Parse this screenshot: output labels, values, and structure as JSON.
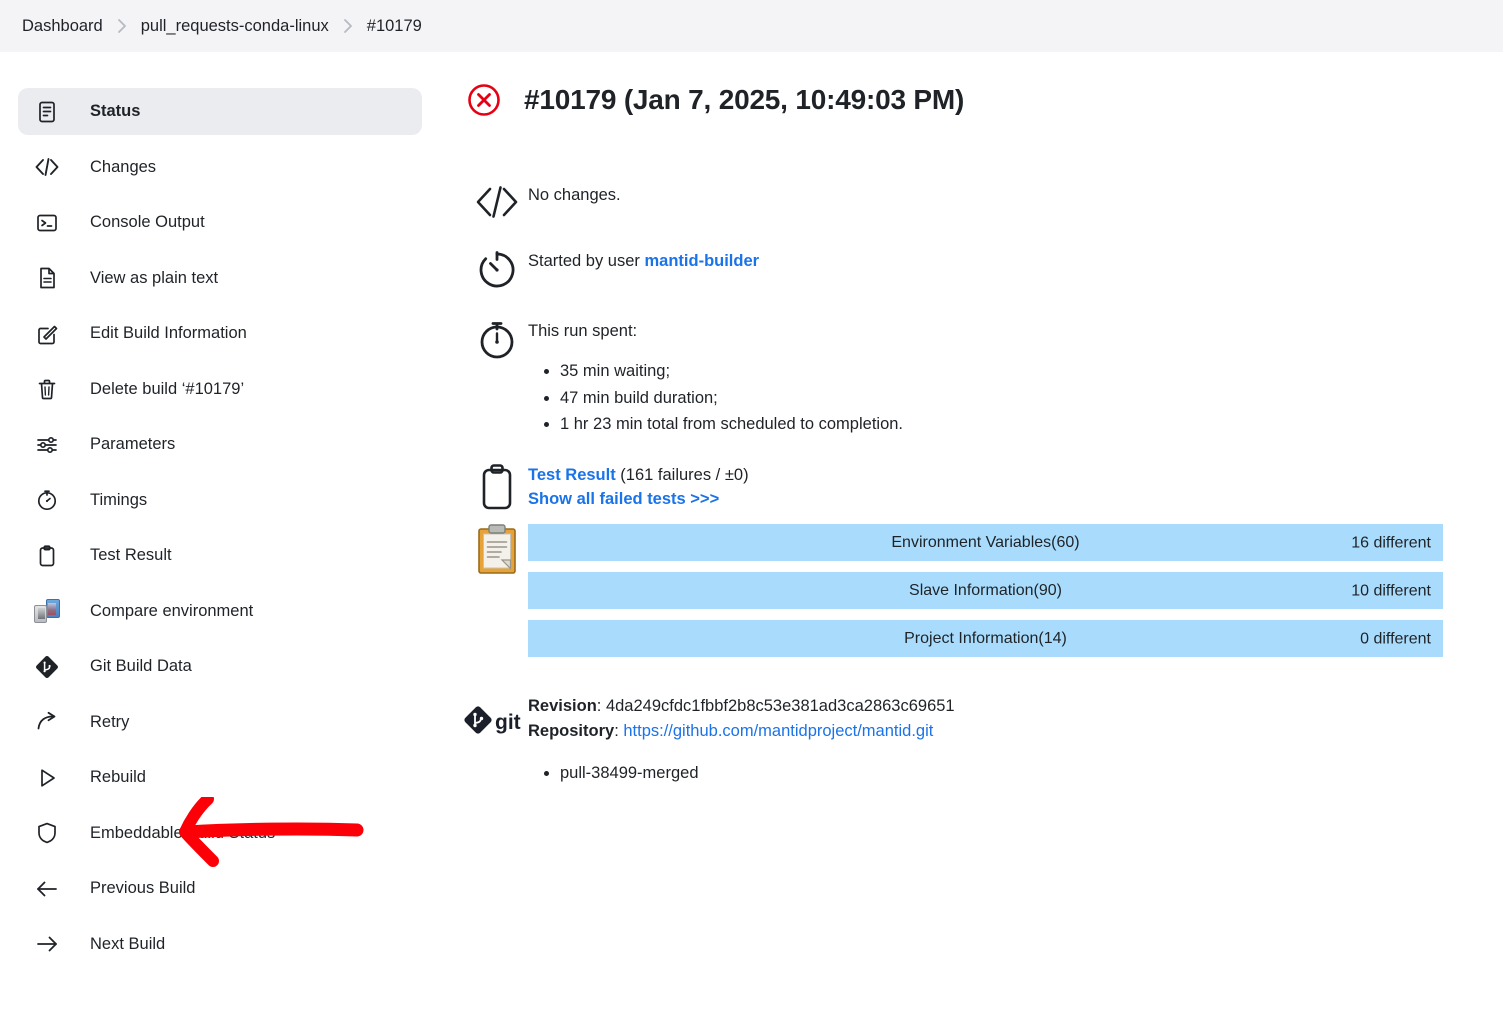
{
  "breadcrumb": {
    "items": [
      {
        "label": "Dashboard"
      },
      {
        "label": "pull_requests-conda-linux"
      },
      {
        "label": "#10179"
      }
    ]
  },
  "sidebar": {
    "items": [
      {
        "label": "Status",
        "icon": "document-lines-icon",
        "active": true
      },
      {
        "label": "Changes",
        "icon": "code-brackets-icon",
        "active": false
      },
      {
        "label": "Console Output",
        "icon": "terminal-icon",
        "active": false
      },
      {
        "label": "View as plain text",
        "icon": "plain-text-file-icon",
        "active": false
      },
      {
        "label": "Edit Build Information",
        "icon": "edit-pencil-icon",
        "active": false
      },
      {
        "label": "Delete build ‘#10179’",
        "icon": "trash-icon",
        "active": false
      },
      {
        "label": "Parameters",
        "icon": "sliders-icon",
        "active": false
      },
      {
        "label": "Timings",
        "icon": "stopwatch-icon",
        "active": false
      },
      {
        "label": "Test Result",
        "icon": "clipboard-icon",
        "active": false
      },
      {
        "label": "Compare environment",
        "icon": "compare-servers-icon",
        "active": false
      },
      {
        "label": "Git Build Data",
        "icon": "git-diamond-icon",
        "active": false
      },
      {
        "label": "Retry",
        "icon": "retry-arrow-icon",
        "active": false
      },
      {
        "label": "Rebuild",
        "icon": "play-triangle-icon",
        "active": false
      },
      {
        "label": "Embeddable Build Status",
        "icon": "shield-icon",
        "active": false
      },
      {
        "label": "Previous Build",
        "icon": "arrow-left-icon",
        "active": false
      },
      {
        "label": "Next Build",
        "icon": "arrow-right-icon",
        "active": false
      }
    ]
  },
  "annotation": {
    "type": "hand-drawn-arrow",
    "color": "#fb0007",
    "points_to": "Rebuild"
  },
  "build": {
    "status_icon": "failed-circle-x-icon",
    "status_color": "#e60012",
    "title": "#10179 (Jan 7, 2025, 10:49:03 PM)",
    "changes": {
      "icon": "code-brackets-icon",
      "text": "No changes."
    },
    "started_by": {
      "icon": "clock-rotate-icon",
      "prefix": "Started by user ",
      "user": "mantid-builder"
    },
    "run_spent": {
      "icon": "stopwatch-icon",
      "heading": "This run spent:",
      "items": [
        "35 min waiting;",
        "47 min build duration;",
        "1 hr 23 min total from scheduled to completion."
      ]
    },
    "test_result": {
      "icon": "clipboard-outline-icon",
      "secondary_icon": "clipboard-orange-icon",
      "link_label": "Test Result",
      "summary": " (161 failures / ±0)",
      "show_all_label": "Show all failed tests >>>",
      "comparison_bars": [
        {
          "label": "Environment Variables(60)",
          "value": "16 different"
        },
        {
          "label": "Slave Information(90)",
          "value": "10 different"
        },
        {
          "label": "Project Information(14)",
          "value": "0 different"
        }
      ],
      "bar_color": "#a9dcfc"
    },
    "git": {
      "icon": "git-logo-icon",
      "revision_label": "Revision",
      "revision": "4da249cfdc1fbbf2b8c53e381ad3ca2863c69651",
      "repository_label": "Repository",
      "repository_url": "https://github.com/mantidproject/mantid.git",
      "branches": [
        "pull-38499-merged"
      ]
    }
  },
  "theme": {
    "link_color": "#1a73e8",
    "breadcrumb_bg": "#f4f4f6",
    "active_item_bg": "#eaecf0"
  }
}
